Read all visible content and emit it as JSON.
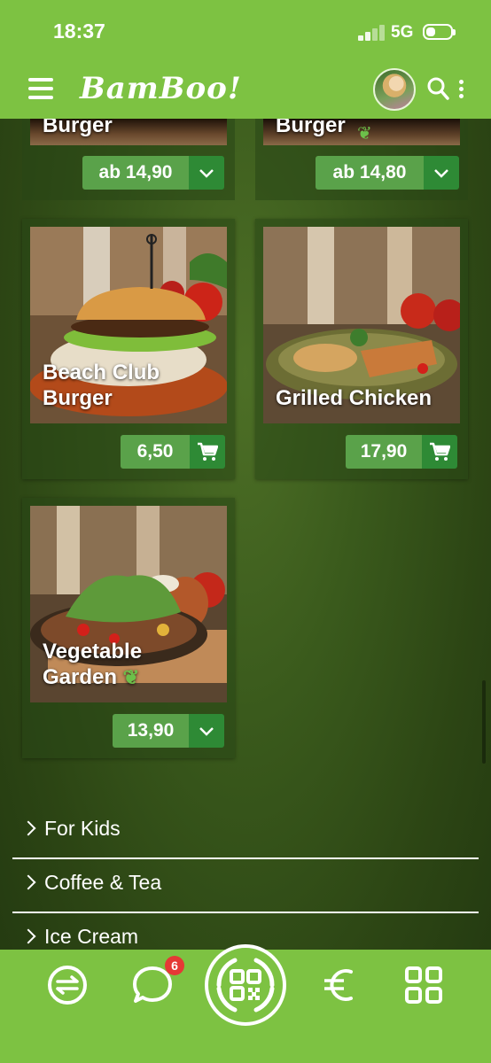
{
  "status_bar": {
    "time": "18:37",
    "network": "5G"
  },
  "header": {
    "logo": "BamBoo!"
  },
  "products": [
    {
      "name": "Burger",
      "price": "ab 14,90",
      "action": "expand"
    },
    {
      "name": "Burger",
      "price": "ab 14,80",
      "action": "expand"
    },
    {
      "name": "Beach Club Burger",
      "name_lines": [
        "Beach Club",
        "Burger"
      ],
      "price": "6,50",
      "action": "cart"
    },
    {
      "name": "Grilled Chicken",
      "name_lines": [
        "Grilled Chicken"
      ],
      "price": "17,90",
      "action": "cart"
    },
    {
      "name": "Vegetable Garden",
      "name_lines": [
        "Vegetable",
        "Garden"
      ],
      "price": "13,90",
      "action": "expand"
    }
  ],
  "categories": [
    {
      "label": "For Kids"
    },
    {
      "label": "Coffee & Tea"
    },
    {
      "label": "Ice Cream"
    }
  ],
  "bottom_nav": {
    "items": [
      {
        "icon": "exchange-icon"
      },
      {
        "icon": "chat-icon",
        "badge": "6"
      },
      {
        "icon": "qr-code-icon"
      },
      {
        "icon": "euro-icon"
      },
      {
        "icon": "grid-icon"
      }
    ]
  },
  "colors": {
    "brand_green": "#7dc242",
    "price_green": "#5aa24a",
    "action_green": "#2e8a35",
    "badge_red": "#e53935"
  }
}
